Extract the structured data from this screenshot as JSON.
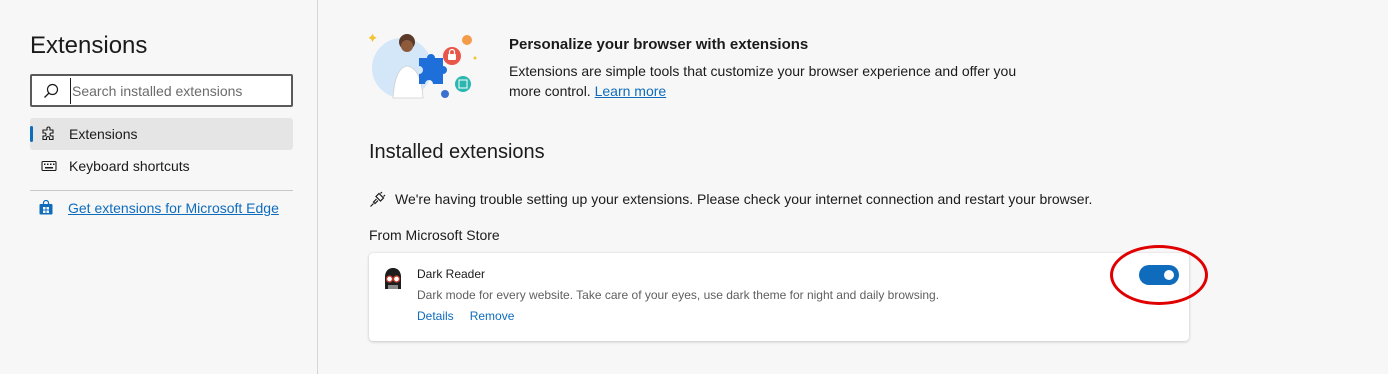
{
  "sidebar": {
    "title": "Extensions",
    "search": {
      "placeholder": "Search installed extensions",
      "value": ""
    },
    "items": [
      {
        "label": "Extensions",
        "icon": "puzzle-icon",
        "active": true
      },
      {
        "label": "Keyboard shortcuts",
        "icon": "keyboard-icon",
        "active": false
      }
    ],
    "get_extensions_link": "Get extensions for Microsoft Edge"
  },
  "main": {
    "hero": {
      "title": "Personalize your browser with extensions",
      "description": "Extensions are simple tools that customize your browser experience and offer you more control.",
      "learn_more": "Learn more"
    },
    "installed_heading": "Installed extensions",
    "warning": "We're having trouble setting up your extensions. Please check your internet connection and restart your browser.",
    "from_store": "From Microsoft Store",
    "extensions": [
      {
        "name": "Dark Reader",
        "description": "Dark mode for every website. Take care of your eyes, use dark theme for night and daily browsing.",
        "details_label": "Details",
        "remove_label": "Remove",
        "enabled": true
      }
    ]
  },
  "colors": {
    "accent": "#0f6cbd",
    "annotation": "#e00000",
    "background": "#f7f7f7"
  }
}
